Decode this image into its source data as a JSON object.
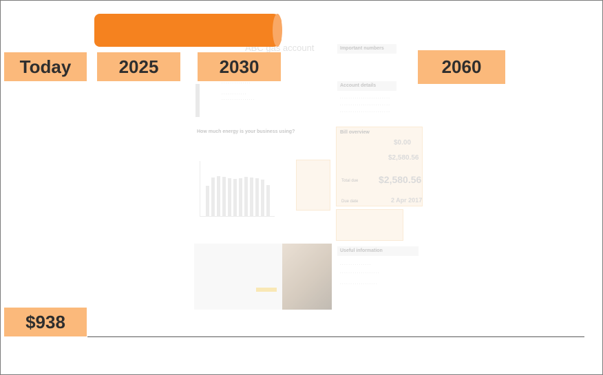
{
  "timeline": {
    "labels": [
      "Today",
      "2025",
      "2030",
      "2060"
    ],
    "value_label": "$938"
  },
  "bill": {
    "heading": "ABC gas account",
    "subheading": "Important numbers",
    "account_details": "Account details",
    "bill_overview": "Bill overview",
    "amount_1": "$0.00",
    "amount_2": "$2,580.56",
    "total_label": "Total due",
    "total_amount": "$2,580.56",
    "due_label": "Due date",
    "due_date": "2 Apr 2017",
    "usage_question": "How much energy is your business using?",
    "useful_info": "Useful information"
  },
  "colors": {
    "range_bar": "#f5821f",
    "label_bg": "#fbb97b",
    "label_text": "#2e2e2e"
  }
}
